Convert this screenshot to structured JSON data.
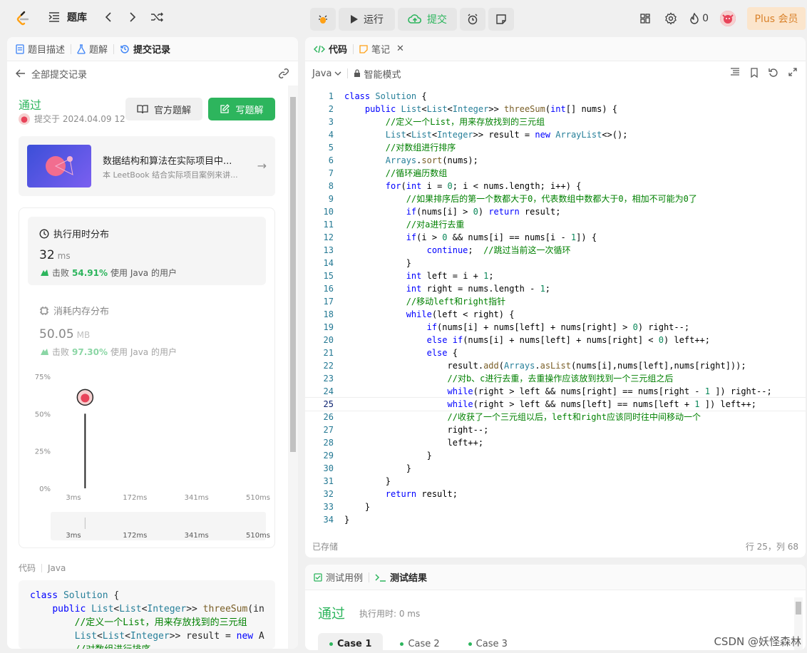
{
  "topbar": {
    "problem_bank": "题库",
    "run_label": "运行",
    "submit_label": "提交",
    "fire_count": "0",
    "plus_label": "Plus 会员"
  },
  "left": {
    "tabs": [
      "题目描述",
      "题解",
      "提交记录"
    ],
    "back_label": "全部提交记录",
    "status": "通过",
    "submitted_at": "提交于 2024.04.09 12",
    "official_btn": "官方题解",
    "write_btn": "写题解",
    "book_title": "数据结构和算法在实际项目中...",
    "book_sub": "本 LeetBook 结合实际项目案例来讲...",
    "runtime": {
      "label": "执行用时分布",
      "value": "32",
      "unit": "ms",
      "beat_prefix": "击败",
      "beat_pct": "54.91%",
      "beat_suffix": "使用 Java 的用户"
    },
    "memory": {
      "label": "消耗内存分布",
      "value": "50.05",
      "unit": "MB",
      "beat_prefix": "击败",
      "beat_pct": "97.30%",
      "beat_suffix": "使用 Java 的用户"
    },
    "code_label": "代码",
    "code_lang": "Java",
    "code_preview": [
      "class Solution {",
      "    public List<List<Integer>> threeSum(in",
      "        //定义一个List，用来存放找到的三元组",
      "        List<List<Integer>> result = new A",
      "        //对数组进行排序"
    ]
  },
  "chart_data": {
    "type": "bar",
    "y_ticks": [
      "75%",
      "50%",
      "25%",
      "0%"
    ],
    "x_ticks": [
      "3ms",
      "172ms",
      "341ms",
      "510ms"
    ],
    "ylim": [
      0,
      75
    ],
    "bars": [
      {
        "x": 35,
        "y": 50
      }
    ],
    "marker_x": 35,
    "brush_ticks": [
      "3ms",
      "172ms",
      "341ms",
      "510ms"
    ]
  },
  "editor": {
    "tabs": [
      "代码",
      "笔记"
    ],
    "lang": "Java",
    "mode": "智能模式",
    "saved": "已存储",
    "position": "行 25，列 68",
    "current_line": 25,
    "lines": [
      "class Solution {",
      "    public List<List<Integer>> threeSum(int[] nums) {",
      "        //定义一个List，用来存放找到的三元组",
      "        List<List<Integer>> result = new ArrayList<>();",
      "        //对数组进行排序",
      "        Arrays.sort(nums);",
      "        //循环遍历数组",
      "        for(int i = 0; i < nums.length; i++) {",
      "            //如果排序后的第一个数都大于0，代表数组中数都大于0，相加不可能为0了",
      "            if(nums[i] > 0) return result;",
      "            //对a进行去重",
      "            if(i > 0 && nums[i] == nums[i - 1]) {",
      "                continue;  //跳过当前这一次循环",
      "            }",
      "            int left = i + 1;",
      "            int right = nums.length - 1;",
      "            //移动left和right指针",
      "            while(left < right) {",
      "                if(nums[i] + nums[left] + nums[right] > 0) right--;",
      "                else if(nums[i] + nums[left] + nums[right] < 0) left++;",
      "                else {",
      "                    result.add(Arrays.asList(nums[i],nums[left],nums[right]));",
      "                    //对b、c进行去重，去重操作应该放到找到一个三元组之后",
      "                    while(right > left && nums[right] == nums[right - 1 ]) right--;",
      "                    while(right > left && nums[left] == nums[left + 1 ]) left++;",
      "                    //收获了一个三元组以后，left和right应该同时往中间移动一个",
      "                    right--;",
      "                    left++;",
      "                }",
      "            }",
      "        }",
      "        return result;",
      "    }",
      "}"
    ]
  },
  "bottom": {
    "tabs": [
      "测试用例",
      "测试结果"
    ],
    "status": "通过",
    "time": "执行用时: 0 ms",
    "cases": [
      "Case 1",
      "Case 2",
      "Case 3"
    ]
  },
  "watermark": "CSDN @妖怪森林",
  "colors": {
    "accent_green": "#2db55d",
    "plus_orange": "#d9822b"
  }
}
